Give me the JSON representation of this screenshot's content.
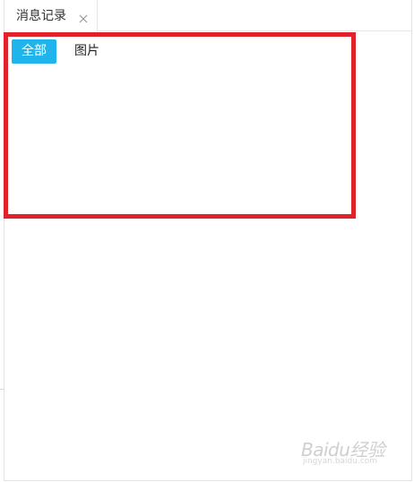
{
  "tab": {
    "label": "消息记录",
    "close_icon": "close-icon"
  },
  "filters": {
    "all_label": "全部",
    "image_label": "图片"
  },
  "colors": {
    "active_filter_bg": "#1fb5ec",
    "highlight_border": "#e0232b"
  },
  "watermark": {
    "text": "Baidu经验",
    "sub": "jingyan.baidu.com"
  }
}
